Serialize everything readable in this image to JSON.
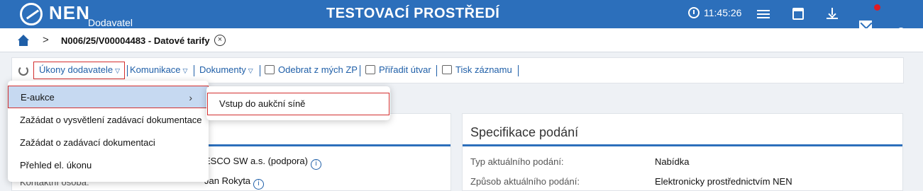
{
  "header": {
    "logo_text": "NEN",
    "logo_sub": "Dodavatel",
    "environment_title": "TESTOVACÍ PROSTŘEDÍ",
    "clock": "11:45:26",
    "icons": [
      "clock-icon",
      "menu-icon",
      "calendar-icon",
      "download-icon",
      "mail-icon",
      "user-icon"
    ],
    "brand_color": "#2c6fbb"
  },
  "breadcrumb": {
    "separator": ">",
    "current": "N006/25/V00004483 - Datové tarify",
    "close": "×"
  },
  "toolbar": {
    "items": [
      {
        "label": "Úkony dodavatele",
        "caret": "▽"
      },
      {
        "label": "Komunikace",
        "caret": "▽"
      },
      {
        "label": "Dokumenty",
        "caret": "▽"
      },
      {
        "label": "Odebrat z mých ZP"
      },
      {
        "label": "Přiřadit útvar"
      },
      {
        "label": "Tisk záznamu"
      }
    ]
  },
  "dropdown": {
    "items": [
      {
        "label": "E-aukce",
        "chevron": "›"
      },
      {
        "label": "Zažádat o vysvětlení zadávací dokumentace"
      },
      {
        "label": "Zažádat o zadávací dokumentaci"
      },
      {
        "label": "Přehled el. úkonu"
      }
    ],
    "submenu": [
      {
        "label": "Vstup do aukční síně"
      }
    ]
  },
  "left_panel": {
    "rows": [
      {
        "value": "ESCO SW a.s. (podpora)"
      },
      {
        "label": "Kontaktní osoba:",
        "value": "Jan Rokyta"
      }
    ]
  },
  "right_panel": {
    "title": "Specifikace podání",
    "rows": [
      {
        "label": "Typ aktuálního podání:",
        "value": "Nabídka"
      },
      {
        "label": "Způsob aktuálního podání:",
        "value": "Elektronicky prostřednictvím NEN"
      }
    ]
  }
}
